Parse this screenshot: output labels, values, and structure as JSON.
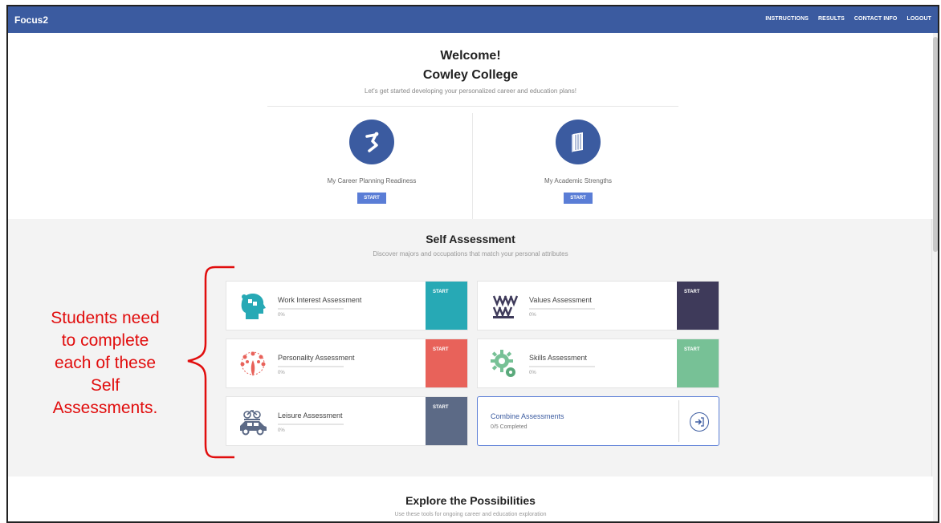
{
  "app": {
    "brand": "Focus2",
    "nav": [
      "INSTRUCTIONS",
      "RESULTS",
      "CONTACT INFO",
      "LOGOUT"
    ]
  },
  "welcome": {
    "title": "Welcome!",
    "college": "Cowley College",
    "subtitle": "Let's get started developing your personalized career and education plans!",
    "items": [
      {
        "label": "My Career Planning Readiness",
        "button": "START",
        "icon": "runner-icon"
      },
      {
        "label": "My Academic Strengths",
        "button": "START",
        "icon": "book-icon"
      }
    ]
  },
  "self_assessment": {
    "title": "Self Assessment",
    "subtitle": "Discover majors and occupations that match your personal attributes",
    "cards": [
      {
        "label": "Work Interest Assessment",
        "percent": "0%",
        "button": "START",
        "color": "#27a9b5",
        "icon": "head-puzzle-icon"
      },
      {
        "label": "Values Assessment",
        "percent": "0%",
        "button": "START",
        "color": "#3e3a5a",
        "icon": "chevrons-icon"
      },
      {
        "label": "Personality Assessment",
        "percent": "0%",
        "button": "START",
        "color": "#e8625a",
        "icon": "peacock-icon"
      },
      {
        "label": "Skills Assessment",
        "percent": "0%",
        "button": "START",
        "color": "#77c196",
        "icon": "gear-icon"
      },
      {
        "label": "Leisure Assessment",
        "percent": "0%",
        "button": "START",
        "color": "#5c6a86",
        "icon": "car-bike-icon"
      }
    ],
    "combine": {
      "label": "Combine Assessments",
      "sub": "0/5 Completed",
      "icon": "enter-circle-icon"
    }
  },
  "explore": {
    "title": "Explore the Possibilities",
    "subtitle": "Use these tools for ongoing career and education exploration"
  },
  "annotation": {
    "lines": [
      "Students need",
      "to complete",
      "each of these",
      "Self",
      "Assessments."
    ],
    "color": "#e10d0d"
  }
}
